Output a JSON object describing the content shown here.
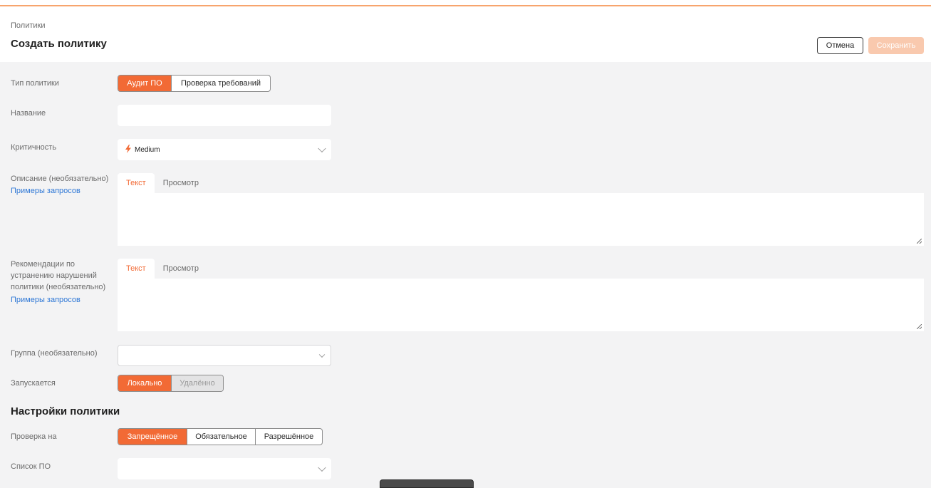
{
  "header": {
    "breadcrumb": "Политики",
    "title": "Создать политику",
    "cancel_label": "Отмена",
    "save_label": "Сохранить"
  },
  "form": {
    "policy_type": {
      "label": "Тип политики",
      "options": [
        "Аудит ПО",
        "Проверка требований"
      ],
      "selected": "Аудит ПО"
    },
    "name": {
      "label": "Название",
      "value": ""
    },
    "severity": {
      "label": "Критичность",
      "value": "Medium",
      "icon": "lightning-icon"
    },
    "description": {
      "label": "Описание (необязательно)",
      "link": "Примеры запросов",
      "tabs": [
        "Текст",
        "Просмотр"
      ],
      "active_tab": "Текст",
      "value": ""
    },
    "remediation": {
      "label_line1": "Рекомендации по",
      "label_line2": "устранению нарушений",
      "label_line3": "политики (необязательно)",
      "link": "Примеры запросов",
      "tabs": [
        "Текст",
        "Просмотр"
      ],
      "active_tab": "Текст",
      "value": ""
    },
    "group": {
      "label": "Группа (необязательно)",
      "value": ""
    },
    "runs": {
      "label": "Запускается",
      "options": [
        "Локально",
        "Удалённо"
      ],
      "selected": "Локально",
      "disabled": "Удалённо"
    }
  },
  "settings": {
    "title": "Настройки политики",
    "check_for": {
      "label": "Проверка на",
      "options": [
        "Запрещённое",
        "Обязательное",
        "Разрешённое"
      ],
      "selected": "Запрещённое"
    },
    "software_list": {
      "label": "Список ПО",
      "value": ""
    }
  },
  "colors": {
    "accent": "#f26a35",
    "accent_disabled": "#f9c9ae",
    "link": "#2f78d6",
    "background": "#f3f3f4"
  }
}
